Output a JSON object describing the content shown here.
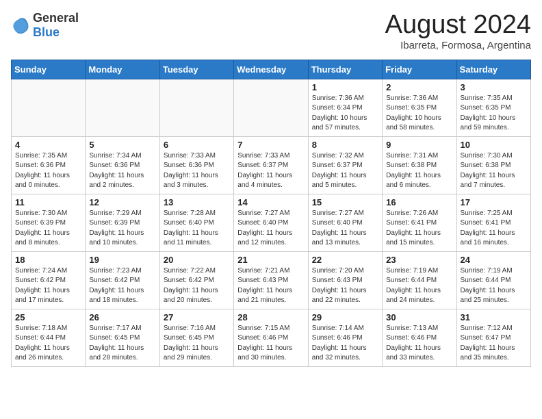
{
  "header": {
    "logo_general": "General",
    "logo_blue": "Blue",
    "month_year": "August 2024",
    "location": "Ibarreta, Formosa, Argentina"
  },
  "days_of_week": [
    "Sunday",
    "Monday",
    "Tuesday",
    "Wednesday",
    "Thursday",
    "Friday",
    "Saturday"
  ],
  "weeks": [
    [
      {
        "day": "",
        "info": ""
      },
      {
        "day": "",
        "info": ""
      },
      {
        "day": "",
        "info": ""
      },
      {
        "day": "",
        "info": ""
      },
      {
        "day": "1",
        "info": "Sunrise: 7:36 AM\nSunset: 6:34 PM\nDaylight: 10 hours\nand 57 minutes."
      },
      {
        "day": "2",
        "info": "Sunrise: 7:36 AM\nSunset: 6:35 PM\nDaylight: 10 hours\nand 58 minutes."
      },
      {
        "day": "3",
        "info": "Sunrise: 7:35 AM\nSunset: 6:35 PM\nDaylight: 10 hours\nand 59 minutes."
      }
    ],
    [
      {
        "day": "4",
        "info": "Sunrise: 7:35 AM\nSunset: 6:36 PM\nDaylight: 11 hours\nand 0 minutes."
      },
      {
        "day": "5",
        "info": "Sunrise: 7:34 AM\nSunset: 6:36 PM\nDaylight: 11 hours\nand 2 minutes."
      },
      {
        "day": "6",
        "info": "Sunrise: 7:33 AM\nSunset: 6:36 PM\nDaylight: 11 hours\nand 3 minutes."
      },
      {
        "day": "7",
        "info": "Sunrise: 7:33 AM\nSunset: 6:37 PM\nDaylight: 11 hours\nand 4 minutes."
      },
      {
        "day": "8",
        "info": "Sunrise: 7:32 AM\nSunset: 6:37 PM\nDaylight: 11 hours\nand 5 minutes."
      },
      {
        "day": "9",
        "info": "Sunrise: 7:31 AM\nSunset: 6:38 PM\nDaylight: 11 hours\nand 6 minutes."
      },
      {
        "day": "10",
        "info": "Sunrise: 7:30 AM\nSunset: 6:38 PM\nDaylight: 11 hours\nand 7 minutes."
      }
    ],
    [
      {
        "day": "11",
        "info": "Sunrise: 7:30 AM\nSunset: 6:39 PM\nDaylight: 11 hours\nand 8 minutes."
      },
      {
        "day": "12",
        "info": "Sunrise: 7:29 AM\nSunset: 6:39 PM\nDaylight: 11 hours\nand 10 minutes."
      },
      {
        "day": "13",
        "info": "Sunrise: 7:28 AM\nSunset: 6:40 PM\nDaylight: 11 hours\nand 11 minutes."
      },
      {
        "day": "14",
        "info": "Sunrise: 7:27 AM\nSunset: 6:40 PM\nDaylight: 11 hours\nand 12 minutes."
      },
      {
        "day": "15",
        "info": "Sunrise: 7:27 AM\nSunset: 6:40 PM\nDaylight: 11 hours\nand 13 minutes."
      },
      {
        "day": "16",
        "info": "Sunrise: 7:26 AM\nSunset: 6:41 PM\nDaylight: 11 hours\nand 15 minutes."
      },
      {
        "day": "17",
        "info": "Sunrise: 7:25 AM\nSunset: 6:41 PM\nDaylight: 11 hours\nand 16 minutes."
      }
    ],
    [
      {
        "day": "18",
        "info": "Sunrise: 7:24 AM\nSunset: 6:42 PM\nDaylight: 11 hours\nand 17 minutes."
      },
      {
        "day": "19",
        "info": "Sunrise: 7:23 AM\nSunset: 6:42 PM\nDaylight: 11 hours\nand 18 minutes."
      },
      {
        "day": "20",
        "info": "Sunrise: 7:22 AM\nSunset: 6:42 PM\nDaylight: 11 hours\nand 20 minutes."
      },
      {
        "day": "21",
        "info": "Sunrise: 7:21 AM\nSunset: 6:43 PM\nDaylight: 11 hours\nand 21 minutes."
      },
      {
        "day": "22",
        "info": "Sunrise: 7:20 AM\nSunset: 6:43 PM\nDaylight: 11 hours\nand 22 minutes."
      },
      {
        "day": "23",
        "info": "Sunrise: 7:19 AM\nSunset: 6:44 PM\nDaylight: 11 hours\nand 24 minutes."
      },
      {
        "day": "24",
        "info": "Sunrise: 7:19 AM\nSunset: 6:44 PM\nDaylight: 11 hours\nand 25 minutes."
      }
    ],
    [
      {
        "day": "25",
        "info": "Sunrise: 7:18 AM\nSunset: 6:44 PM\nDaylight: 11 hours\nand 26 minutes."
      },
      {
        "day": "26",
        "info": "Sunrise: 7:17 AM\nSunset: 6:45 PM\nDaylight: 11 hours\nand 28 minutes."
      },
      {
        "day": "27",
        "info": "Sunrise: 7:16 AM\nSunset: 6:45 PM\nDaylight: 11 hours\nand 29 minutes."
      },
      {
        "day": "28",
        "info": "Sunrise: 7:15 AM\nSunset: 6:46 PM\nDaylight: 11 hours\nand 30 minutes."
      },
      {
        "day": "29",
        "info": "Sunrise: 7:14 AM\nSunset: 6:46 PM\nDaylight: 11 hours\nand 32 minutes."
      },
      {
        "day": "30",
        "info": "Sunrise: 7:13 AM\nSunset: 6:46 PM\nDaylight: 11 hours\nand 33 minutes."
      },
      {
        "day": "31",
        "info": "Sunrise: 7:12 AM\nSunset: 6:47 PM\nDaylight: 11 hours\nand 35 minutes."
      }
    ]
  ]
}
